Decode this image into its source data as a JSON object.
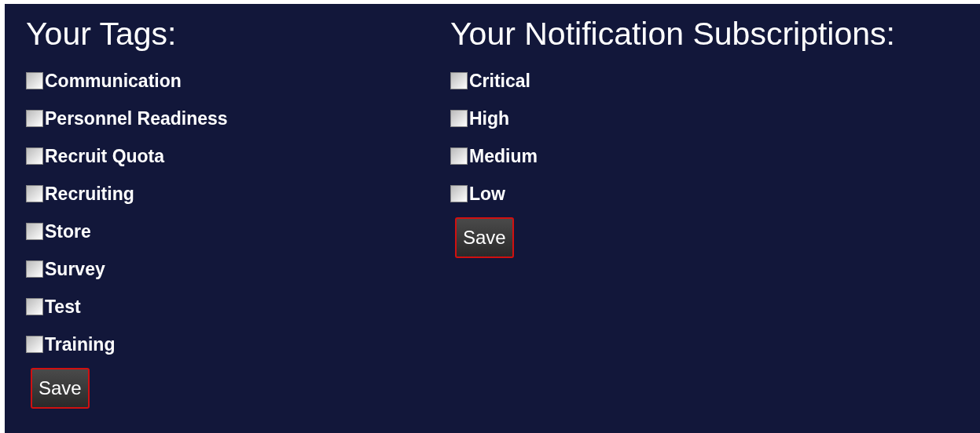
{
  "sections": [
    {
      "title": "Your Tags:",
      "items": [
        {
          "label": "Communication",
          "checked": false
        },
        {
          "label": "Personnel Readiness",
          "checked": false
        },
        {
          "label": "Recruit Quota",
          "checked": false
        },
        {
          "label": "Recruiting",
          "checked": false
        },
        {
          "label": "Store",
          "checked": false
        },
        {
          "label": "Survey",
          "checked": false
        },
        {
          "label": "Test",
          "checked": false
        },
        {
          "label": "Training",
          "checked": false
        }
      ],
      "button": "Save"
    },
    {
      "title": "Your Notification Subscriptions:",
      "items": [
        {
          "label": "Critical",
          "checked": false
        },
        {
          "label": "High",
          "checked": false
        },
        {
          "label": "Medium",
          "checked": false
        },
        {
          "label": "Low",
          "checked": false
        }
      ],
      "button": "Save"
    }
  ]
}
